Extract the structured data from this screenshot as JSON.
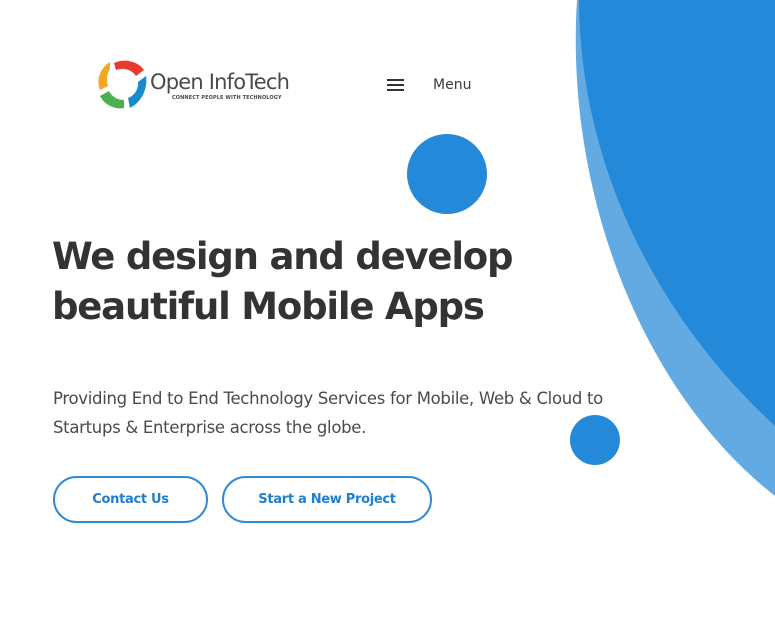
{
  "brand": {
    "name": "Open InfoTech",
    "tagline": "CONNECT PEOPLE WITH TECHNOLOGY"
  },
  "nav": {
    "menu_label": "Menu",
    "menu_icon": "hamburger-icon"
  },
  "hero": {
    "headline": "We design and develop beautiful Mobile Apps",
    "subtext": "Providing End to End Technology Services for Mobile, Web & Cloud to Startups & Enterprise across the globe."
  },
  "actions": {
    "contact_label": "Contact Us",
    "project_label": "Start a New Project"
  },
  "colors": {
    "accent": "#2389d8",
    "accent_light": "#63aae3",
    "text_dark": "#333333",
    "logo_orange": "#f5a623",
    "logo_red": "#e63b2e",
    "logo_blue": "#1a8ad0",
    "logo_green": "#4caf50"
  }
}
